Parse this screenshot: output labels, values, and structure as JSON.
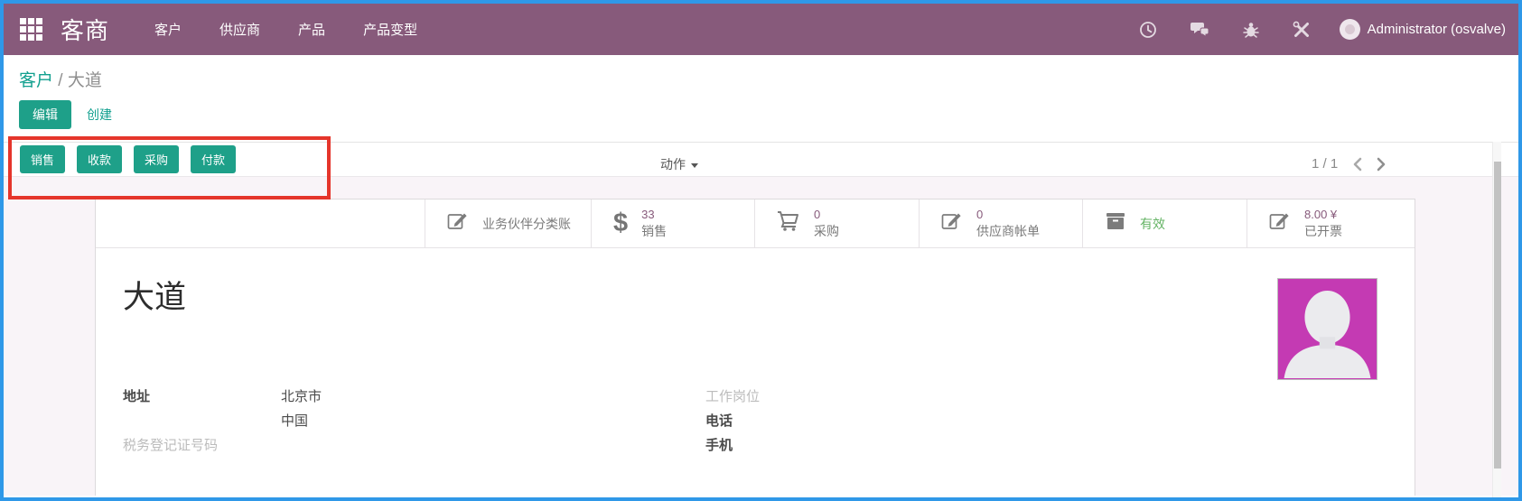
{
  "navbar": {
    "app_name": "客商",
    "menu": [
      "客户",
      "供应商",
      "产品",
      "产品变型"
    ],
    "icons": [
      "apps-grid-icon",
      "clock-icon",
      "messages-icon",
      "bug-icon",
      "tools-icon"
    ],
    "user_name": "Administrator (osvalve)"
  },
  "breadcrumb": {
    "parent": "客户",
    "separator": "/",
    "current": "大道"
  },
  "control_panel": {
    "edit_label": "编辑",
    "create_label": "创建",
    "actions_label": "动作",
    "pager": "1 / 1"
  },
  "smart_buttons": [
    "销售",
    "收款",
    "采购",
    "付款"
  ],
  "stat_buttons": [
    {
      "icon": "edit-document-icon",
      "label": "业务伙伴分类账"
    },
    {
      "icon": "dollar-icon",
      "dollar_glyph": "$",
      "value": "33",
      "label": "销售"
    },
    {
      "icon": "cart-icon",
      "value": "0",
      "label": "采购"
    },
    {
      "icon": "edit-document-icon",
      "value": "0",
      "label": "供应商帐单"
    },
    {
      "icon": "archive-box-icon",
      "label": "有效"
    },
    {
      "icon": "edit-document-icon",
      "value": "8.00 ¥",
      "label": "已开票"
    }
  ],
  "form": {
    "title": "大道",
    "avatar_icon": "person-silhouette-icon",
    "left_fields": [
      {
        "label": "地址",
        "value": "北京市"
      },
      {
        "label": "",
        "value": "中国"
      },
      {
        "label": "税务登记证号码",
        "value": ""
      }
    ],
    "right_fields": [
      {
        "label": "工作岗位"
      },
      {
        "label": "电话"
      },
      {
        "label": "手机"
      }
    ]
  },
  "colors": {
    "navbar_purple": "#875a7b",
    "primary_teal": "#1ea089",
    "stat_value_purple": "#875a7b",
    "active_green": "#64b364",
    "avatar_magenta": "#c43ab3",
    "annotation_red": "#e5352b",
    "frame_blue": "#2f98e8",
    "content_bg": "#f9f4f8"
  }
}
